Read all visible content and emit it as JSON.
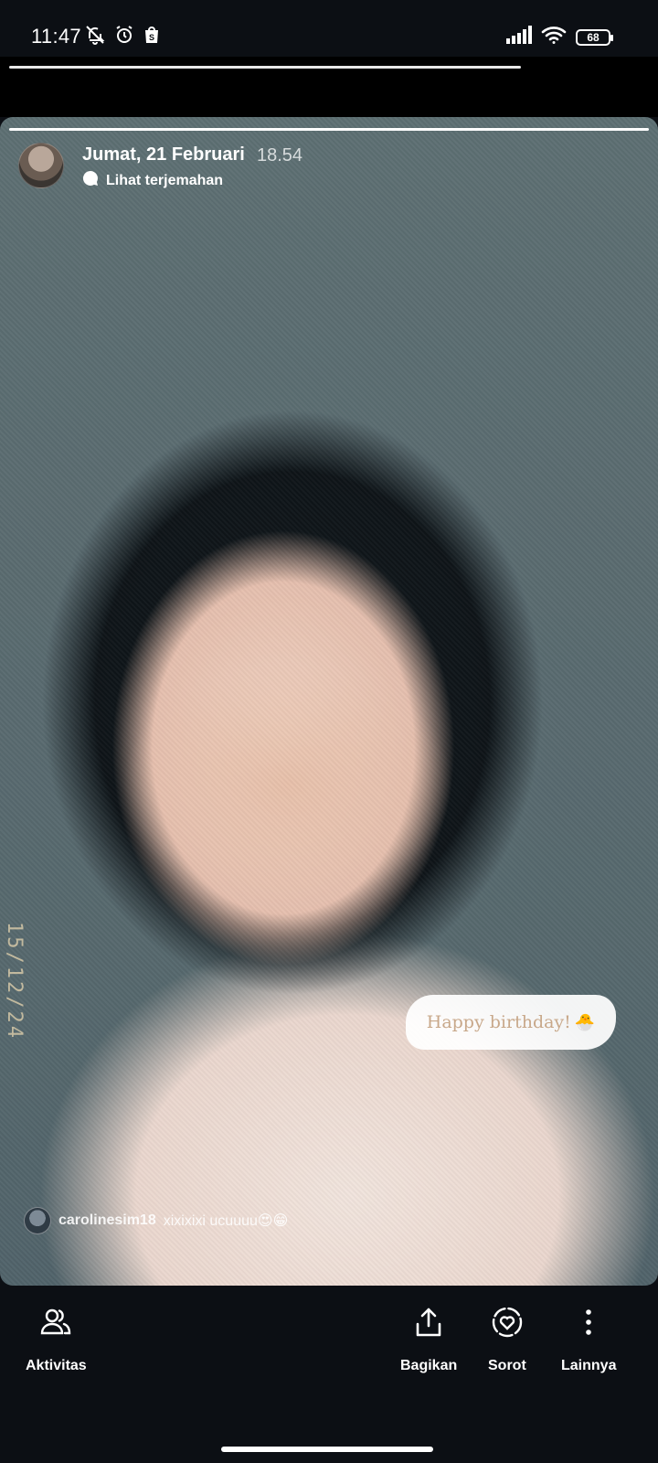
{
  "status_bar": {
    "time": "11:47",
    "battery": "68",
    "left_icons": [
      "mute-notification-icon",
      "alarm-icon",
      "shopee-icon"
    ],
    "right_icons": [
      "signal-icon",
      "wifi-icon",
      "battery-icon"
    ]
  },
  "story": {
    "date": "Jumat, 21 Februari",
    "time": "18.54",
    "translate_label": "Lihat terjemahan",
    "progress": 1.0,
    "date_stamp": "15/12/24",
    "sticker_text": "Happy birthday!",
    "sticker_emoji": "🐣",
    "comment": {
      "username": "carolinesim18",
      "text": "xixixixi ucuuuu😍😁"
    }
  },
  "actions": {
    "activity": "Aktivitas",
    "share": "Bagikan",
    "highlight": "Sorot",
    "more": "Lainnya"
  }
}
